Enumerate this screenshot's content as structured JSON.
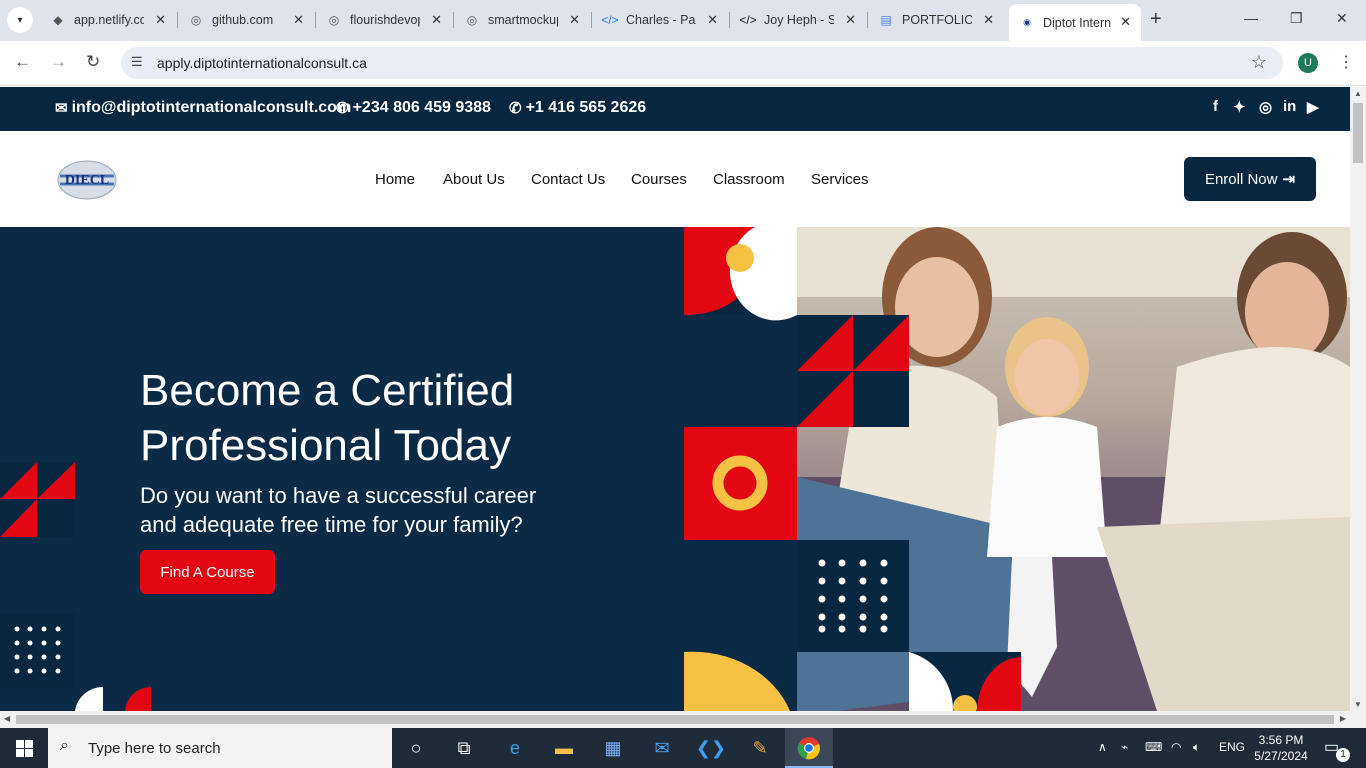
{
  "browser": {
    "tabs": [
      {
        "label": "app.netlify.com",
        "icon": "netlify-icon"
      },
      {
        "label": "github.com",
        "icon": "globe-icon"
      },
      {
        "label": "flourishdevops",
        "icon": "globe-icon"
      },
      {
        "label": "smartmockups",
        "icon": "globe-icon"
      },
      {
        "label": "Charles - Pas",
        "icon": "code-icon"
      },
      {
        "label": "Joy Heph - S",
        "icon": "code-icon"
      },
      {
        "label": "PORTFOLIO",
        "icon": "docs-icon"
      },
      {
        "label": "Diptot Intern",
        "icon": "site-icon",
        "active": true
      }
    ],
    "url": "apply.diptotinternationalconsult.ca",
    "profile_initial": "U"
  },
  "site": {
    "contact": {
      "email": "info@diptotinternationalconsult.com",
      "phone1": "+234 806 459 9388",
      "phone2": "+1 416 565 2626"
    },
    "social": [
      "facebook-icon",
      "twitter-icon",
      "instagram-icon",
      "linkedin-icon",
      "youtube-icon"
    ],
    "logo_text": "DIECL",
    "nav": [
      "Home",
      "About Us",
      "Contact Us",
      "Courses",
      "Classroom",
      "Services"
    ],
    "enroll_label": "Enroll Now",
    "hero": {
      "title": "Become a Certified Professional Today",
      "subtitle": "Do you want to have a successful career and adequate free time for your family?",
      "button": "Find A Course"
    },
    "colors": {
      "navy": "#072640",
      "red": "#e30613",
      "yellow": "#f7c244"
    }
  },
  "taskbar": {
    "search_placeholder": "Type here to search",
    "language": "ENG",
    "time": "3:56 PM",
    "date": "5/27/2024",
    "notification_count": "1"
  }
}
